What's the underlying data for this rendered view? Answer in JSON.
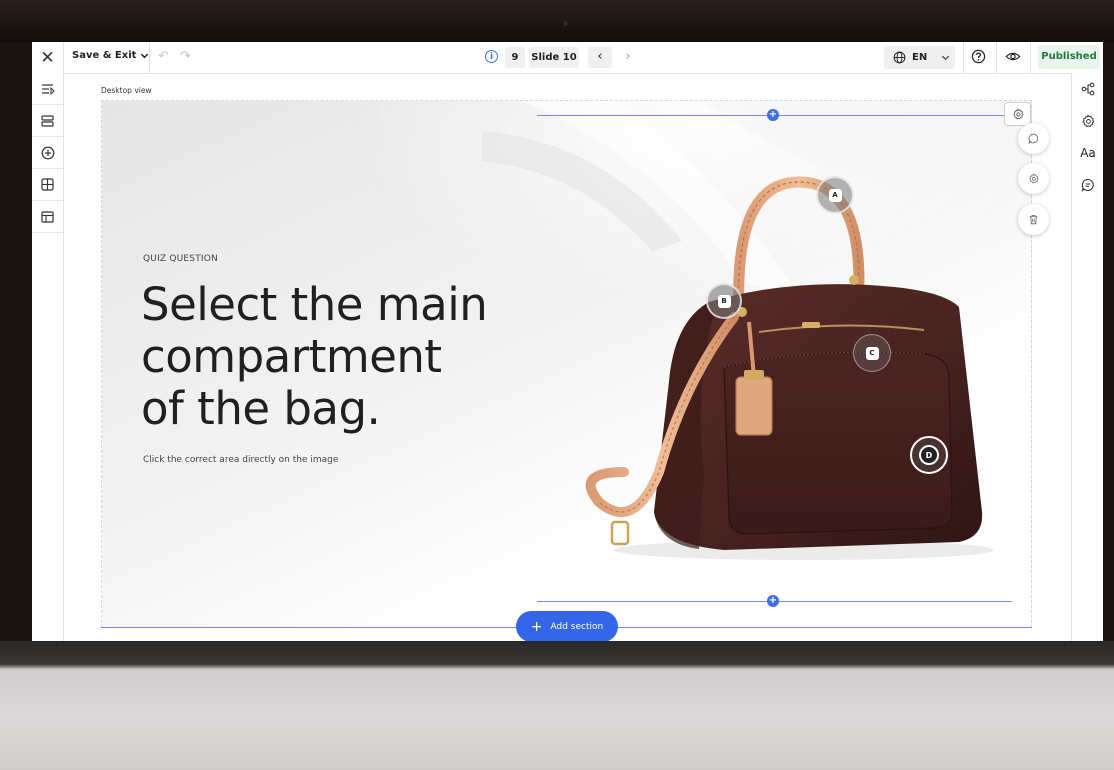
{
  "toolbar": {
    "save_label": "Save & Exit",
    "slide_number": "9",
    "slide_label": "Slide 10",
    "language": "EN",
    "status": "Published"
  },
  "canvas": {
    "view_label": "Desktop view"
  },
  "quiz": {
    "kicker": "QUIZ QUESTION",
    "title_lines": [
      "Select the main",
      "compartment",
      "of the bag."
    ],
    "subtitle": "Click the correct area directly on the image"
  },
  "hotspots": [
    {
      "label": "A"
    },
    {
      "label": "B"
    },
    {
      "label": "C"
    },
    {
      "label": "D"
    }
  ],
  "add_section_label": "Add section",
  "right_rail": {
    "typography_label": "Aa"
  },
  "colors": {
    "accent": "#3566e8",
    "published_bg": "#e8f4ec",
    "published_text": "#1e7a3c",
    "bag_leather": "#4a2422",
    "strap_leather": "#e7b08a"
  },
  "icons": {
    "left_rail": [
      "outline-icon",
      "layers-icon",
      "add-circle-icon",
      "grid-icon",
      "layout-icon"
    ],
    "right_rail": [
      "connections-icon",
      "settings-icon",
      "typography-icon",
      "comment-icon"
    ]
  }
}
